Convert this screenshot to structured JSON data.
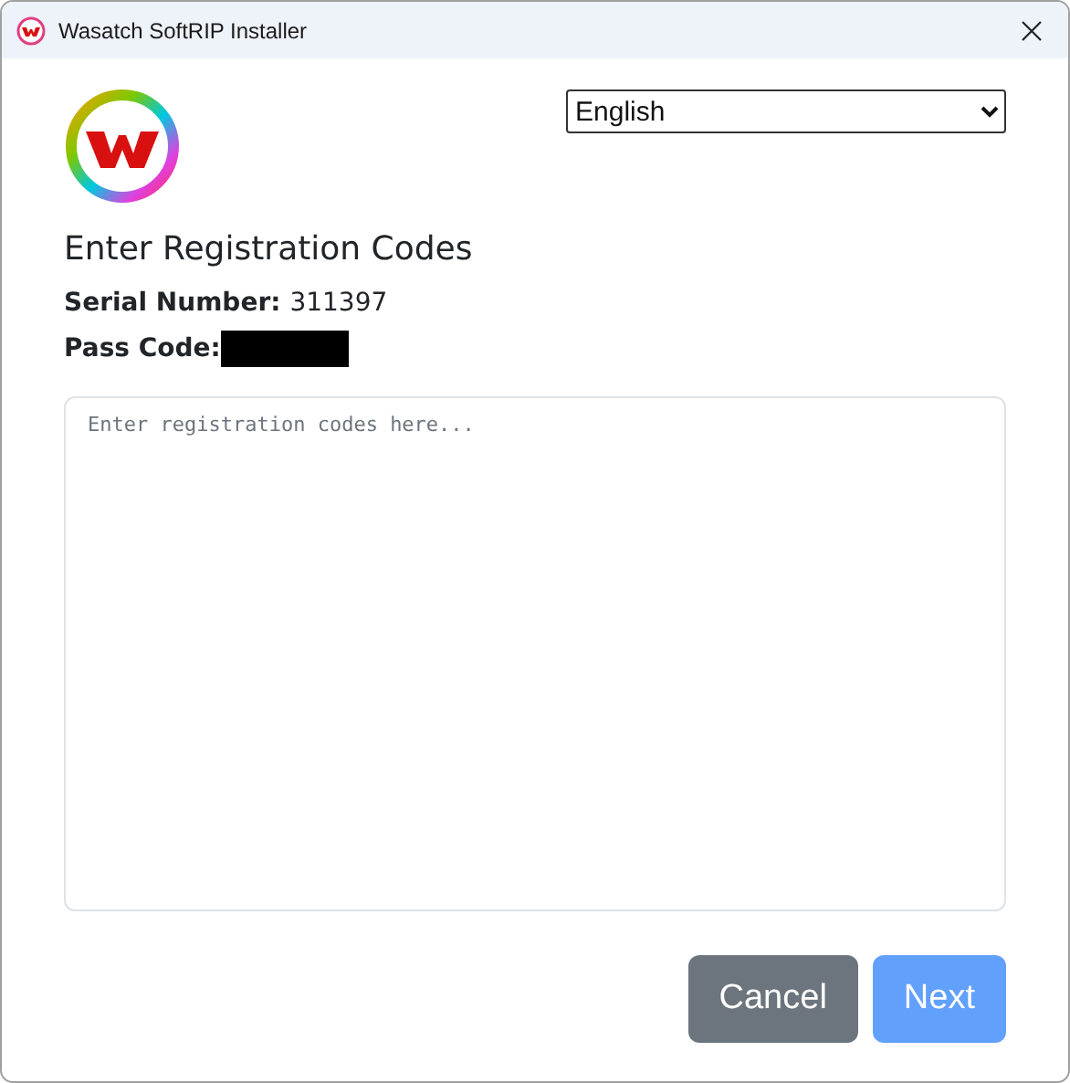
{
  "window": {
    "title": "Wasatch SoftRIP Installer"
  },
  "language": {
    "value": "English"
  },
  "heading": "Enter Registration Codes",
  "fields": [
    {
      "label": "Serial Number:",
      "value": "311397",
      "redacted": false
    },
    {
      "label": "Pass Code:",
      "redacted": true
    }
  ],
  "codes": {
    "placeholder": "Enter registration codes here..."
  },
  "buttons": [
    {
      "label": "Cancel",
      "kind": "secondary",
      "disabled": false
    },
    {
      "label": "Next",
      "kind": "primary",
      "disabled": true
    }
  ]
}
